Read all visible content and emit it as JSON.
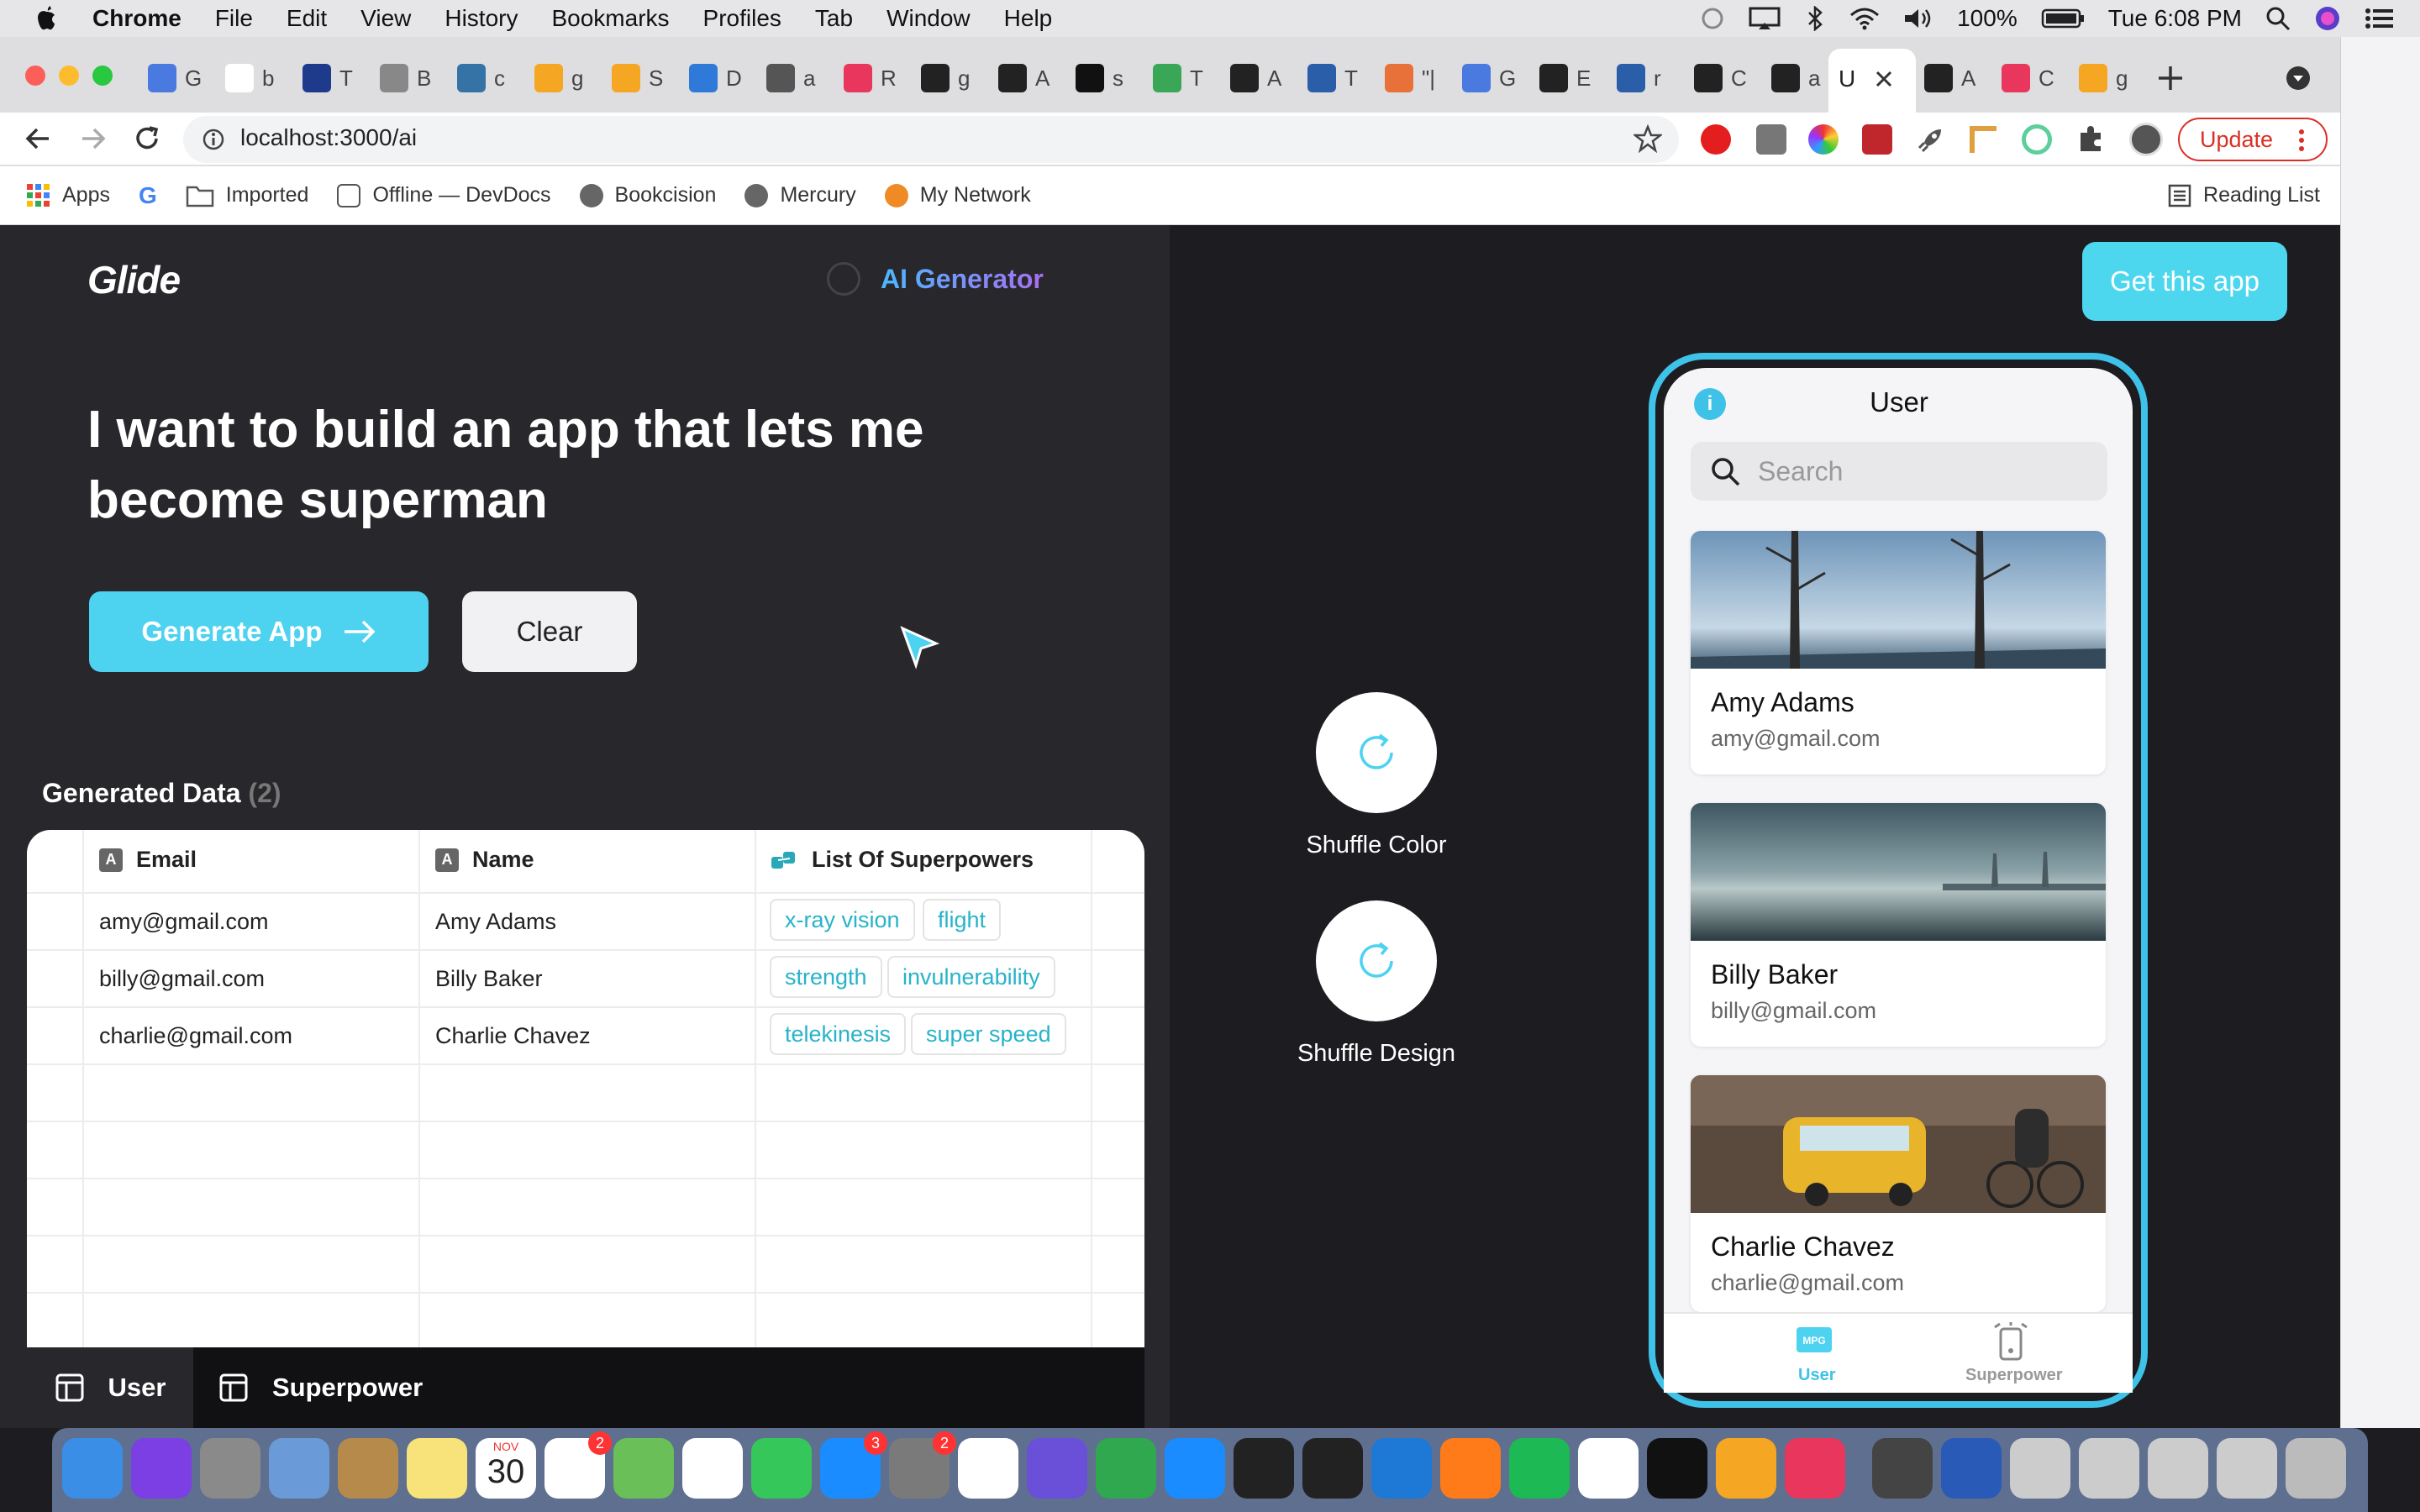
{
  "menubar": {
    "app_name": "Chrome",
    "items": [
      "File",
      "Edit",
      "View",
      "History",
      "Bookmarks",
      "Profiles",
      "Tab",
      "Window",
      "Help"
    ],
    "battery": "100%",
    "clock": "Tue 6:08 PM"
  },
  "browser": {
    "active_tab_letter": "U",
    "tab_letters": [
      "G",
      "b",
      "T",
      "B",
      "c",
      "g",
      "S",
      "D",
      "a",
      "R",
      "g",
      "A",
      "s",
      "T",
      "A",
      "T",
      "\"|",
      "G",
      "E",
      "r",
      "C",
      "a",
      "A",
      "C",
      "g"
    ],
    "url": "localhost:3000/ai",
    "update_label": "Update",
    "bookmarks": [
      "Apps",
      "Imported",
      "Offline — DevDocs",
      "Bookcision",
      "Mercury",
      "My Network"
    ],
    "reading_list": "Reading List"
  },
  "app": {
    "logo": "Glide",
    "ai_generator_label": "AI Generator",
    "headline": "I want to build an app that lets me become superman",
    "generate_label": "Generate App",
    "clear_label": "Clear",
    "generated_data_title": "Generated Data",
    "generated_data_count": "(2)",
    "table": {
      "columns": [
        "Email",
        "Name",
        "List Of Superpowers"
      ],
      "rows": [
        {
          "email": "amy@gmail.com",
          "name": "Amy Adams",
          "powers": [
            "x-ray vision",
            "flight"
          ]
        },
        {
          "email": "billy@gmail.com",
          "name": "Billy Baker",
          "powers": [
            "strength",
            "invulnerability"
          ]
        },
        {
          "email": "charlie@gmail.com",
          "name": "Charlie Chavez",
          "powers": [
            "telekinesis",
            "super speed"
          ]
        }
      ]
    },
    "tabs": [
      "User",
      "Superpower"
    ],
    "get_app_label": "Get this app",
    "shuffle_color_label": "Shuffle Color",
    "shuffle_design_label": "Shuffle Design"
  },
  "phone": {
    "title": "User",
    "search_placeholder": "Search",
    "cards": [
      {
        "name": "Amy Adams",
        "email": "amy@gmail.com"
      },
      {
        "name": "Billy Baker",
        "email": "billy@gmail.com"
      },
      {
        "name": "Charlie Chavez",
        "email": "charlie@gmail.com"
      }
    ],
    "tab_user": "User",
    "tab_super": "Superpower"
  },
  "dock": {
    "calendar_day": "30",
    "calendar_month": "NOV",
    "badges": [
      "2",
      "3",
      "2"
    ]
  },
  "colors": {
    "accent": "#4dd2f0",
    "chip_text": "#27b3c8",
    "pane_dark": "#27272c"
  }
}
